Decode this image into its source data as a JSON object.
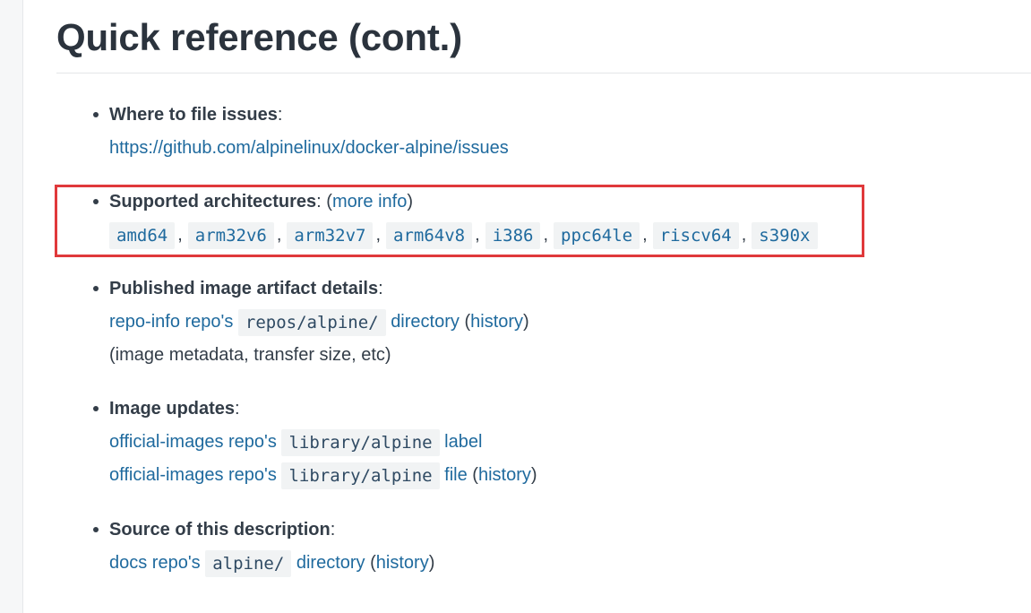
{
  "page": {
    "title": "Quick reference (cont.)"
  },
  "sections": {
    "issues": {
      "heading": "Where to file issues",
      "colon": ":",
      "link": "https://github.com/alpinelinux/docker-alpine/issues"
    },
    "architectures": {
      "heading": "Supported architectures",
      "colon": ": (",
      "more_info": "more info",
      "close": ")",
      "items": [
        "amd64",
        "arm32v6",
        "arm32v7",
        "arm64v8",
        "i386",
        "ppc64le",
        "riscv64",
        "s390x"
      ],
      "separator": ","
    },
    "published": {
      "heading": "Published image artifact details",
      "colon": ":",
      "repo_link": "repo-info repo's",
      "code": "repos/alpine/",
      "directory_link": "directory",
      "open_paren": "(",
      "history_link": "history",
      "close_paren": ")",
      "note": "(image metadata, transfer size, etc)"
    },
    "updates": {
      "heading": "Image updates",
      "colon": ":",
      "line1_link": "official-images repo's",
      "line1_code": "library/alpine",
      "line1_label": "label",
      "line2_link": "official-images repo's",
      "line2_code": "library/alpine",
      "line2_file": "file",
      "open_paren": "(",
      "history_link": "history",
      "close_paren": ")"
    },
    "source": {
      "heading": "Source of this description",
      "colon": ":",
      "docs_link": "docs repo's",
      "code": "alpine/",
      "directory_link": "directory",
      "open_paren": "(",
      "history_link": "history",
      "close_paren": ")"
    }
  },
  "colors": {
    "link": "#1f6a9e",
    "text": "#333d48",
    "highlight_border": "#e0393b",
    "code_background": "#f1f3f4"
  }
}
